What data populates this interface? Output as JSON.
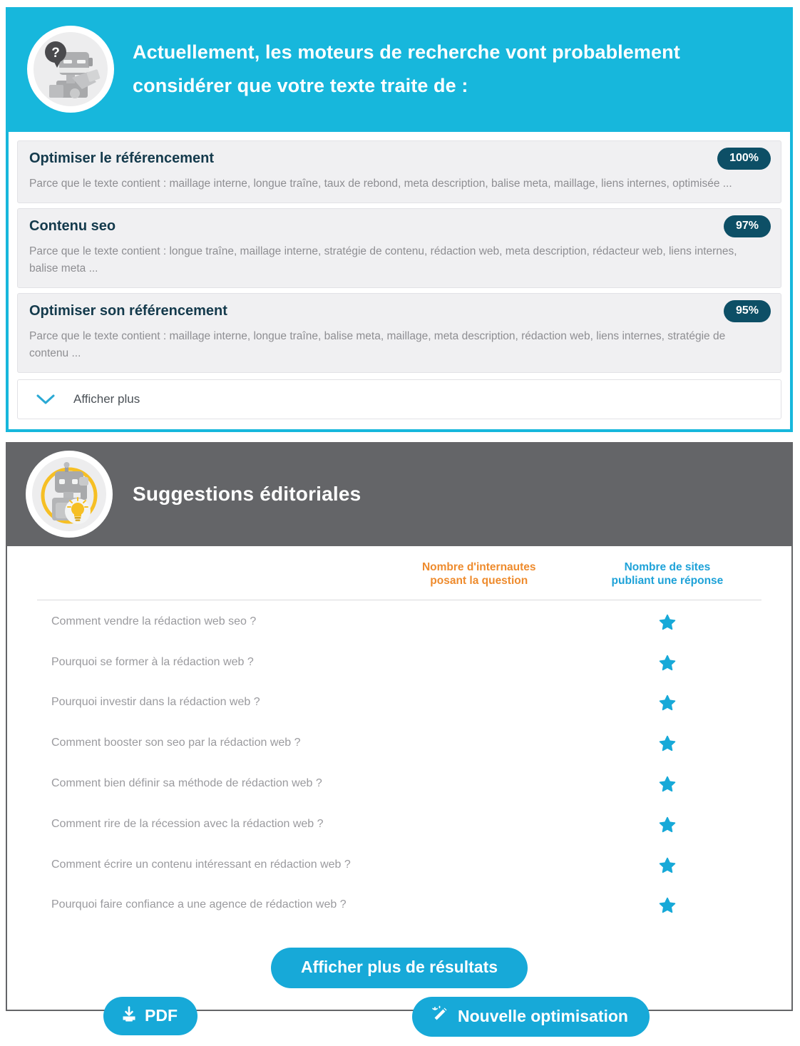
{
  "thematic": {
    "header_title": "Actuellement, les moteurs de recherche vont probablement considérer que votre texte traite de :",
    "avatar_icon": "thinking-robot-icon",
    "accent_color": "#17b7dc",
    "badge_color": "#0d4f66",
    "results": [
      {
        "title": "Optimiser le référencement",
        "score": "100%",
        "reason_prefix": "Parce que le texte contient : ",
        "reason_terms": "maillage interne, longue traîne, taux de rebond, meta description, balise meta, maillage, liens internes, optimisée ..."
      },
      {
        "title": "Contenu seo",
        "score": "97%",
        "reason_prefix": "Parce que le texte contient : ",
        "reason_terms": "longue traîne, maillage interne, stratégie de contenu, rédaction web, meta description, rédacteur web, liens internes, balise meta ..."
      },
      {
        "title": "Optimiser son référencement",
        "score": "95%",
        "reason_prefix": "Parce que le texte contient : ",
        "reason_terms": "maillage interne, longue traîne, balise meta, maillage, meta description, rédaction web, liens internes, stratégie de contenu ..."
      }
    ],
    "show_more_label": "Afficher plus",
    "show_more_icon": "chevron-down-icon"
  },
  "suggestions": {
    "header_title": "Suggestions éditoriales",
    "avatar_icon": "robot-lightbulb-icon",
    "header_color": "#646568",
    "columns": {
      "question": "",
      "asks": "Nombre d'internautes posant la question",
      "asks_line1": "Nombre d'internautes",
      "asks_line2": "posant la question",
      "asks_color": "#ee8b2d",
      "answers": "Nombre de sites publiant une réponse",
      "answers_line1": "Nombre de sites",
      "answers_line2": "publiant une réponse",
      "answers_color": "#1ea2d8"
    },
    "rows": [
      {
        "question": "Comment vendre la rédaction web seo ?",
        "asks": "",
        "answers_icon": "star-icon"
      },
      {
        "question": "Pourquoi se former à la rédaction web ?",
        "asks": "",
        "answers_icon": "star-icon"
      },
      {
        "question": "Pourquoi investir dans la rédaction web ?",
        "asks": "",
        "answers_icon": "star-icon"
      },
      {
        "question": "Comment booster son seo par la rédaction web ?",
        "asks": "",
        "answers_icon": "star-icon"
      },
      {
        "question": "Comment bien définir sa méthode de rédaction web ?",
        "asks": "",
        "answers_icon": "star-icon"
      },
      {
        "question": "Comment rire de la récession avec la rédaction web ?",
        "asks": "",
        "answers_icon": "star-icon"
      },
      {
        "question": "Comment écrire un contenu intéressant en rédaction web ?",
        "asks": "",
        "answers_icon": "star-icon"
      },
      {
        "question": "Pourquoi faire confiance a une agence de rédaction web ?",
        "asks": "",
        "answers_icon": "star-icon"
      }
    ],
    "more_results_label": "Afficher plus de résultats"
  },
  "footer": {
    "pdf_label": "PDF",
    "pdf_icon": "download-icon",
    "new_optimisation_label": "Nouvelle optimisation",
    "new_optimisation_icon": "magic-wand-icon",
    "button_color": "#17a9d8"
  }
}
